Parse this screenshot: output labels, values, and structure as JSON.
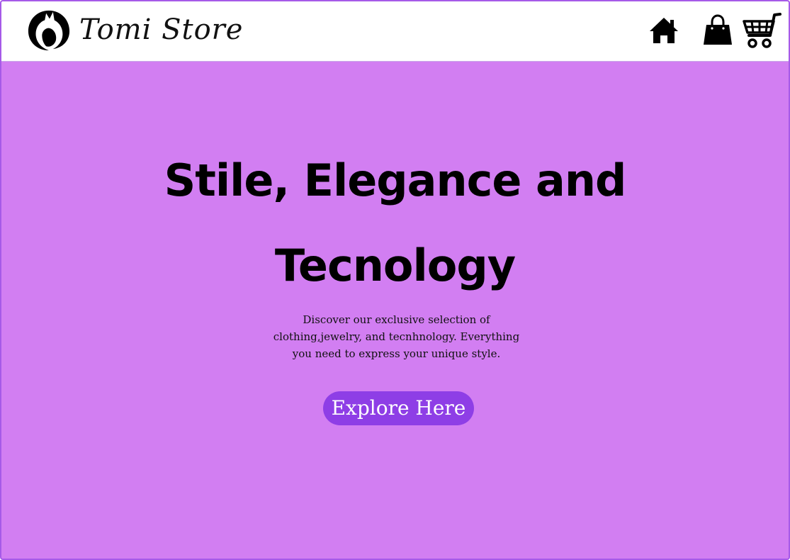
{
  "header": {
    "brand_name": "Tomi Store",
    "logo_icon": "fox-head-logo",
    "nav": [
      {
        "icon": "home-icon"
      },
      {
        "icon": "shopping-bag-icon"
      },
      {
        "icon": "shopping-cart-icon"
      }
    ]
  },
  "hero": {
    "title_line1": "Stile, Elegance and",
    "title_line2": "Tecnology",
    "description": "Discover our exclusive selection of clothing,jewelry, and tecnhnology. Everything you need to express your unique style.",
    "cta_label": "Explore Here"
  },
  "colors": {
    "background": "#d27ef2",
    "header_background": "#ffffff",
    "cta_background": "#8e3ee6",
    "cta_text": "#ffffff",
    "frame_border": "#a65ae8"
  }
}
